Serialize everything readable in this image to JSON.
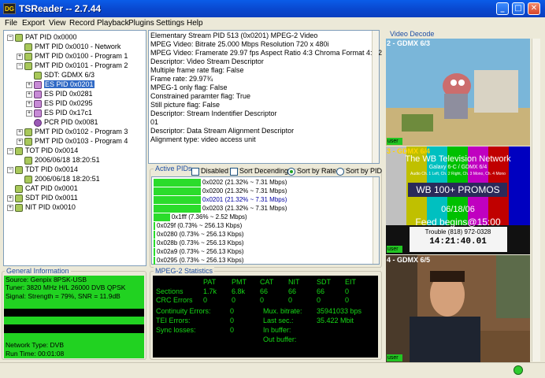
{
  "window": {
    "title": "TSReader -- 2.7.44",
    "app_icon_text": "DG"
  },
  "menu": [
    "File",
    "Export",
    "View",
    "Record",
    "Playback",
    "Plugins",
    "Settings",
    "Help"
  ],
  "tree": [
    {
      "label": "PAT PID 0x0000",
      "indent": 0,
      "exp": "−",
      "icon": "pid"
    },
    {
      "label": "PMT PID 0x0010 - Network",
      "indent": 1,
      "exp": "",
      "icon": "pid"
    },
    {
      "label": "PMT PID 0x0100 - Program 1",
      "indent": 1,
      "exp": "+",
      "icon": "pid"
    },
    {
      "label": "PMT PID 0x0101 - Program 2",
      "indent": 1,
      "exp": "−",
      "icon": "pid"
    },
    {
      "label": "SDT: GDMX 6/3",
      "indent": 2,
      "exp": "",
      "icon": "pid"
    },
    {
      "label": "ES PID 0x0201",
      "indent": 2,
      "exp": "+",
      "icon": "es",
      "selected": true
    },
    {
      "label": "ES PID 0x0281",
      "indent": 2,
      "exp": "+",
      "icon": "es"
    },
    {
      "label": "ES PID 0x0295",
      "indent": 2,
      "exp": "+",
      "icon": "es"
    },
    {
      "label": "ES PID 0x17c1",
      "indent": 2,
      "exp": "+",
      "icon": "es"
    },
    {
      "label": "PCR PID 0x0081",
      "indent": 2,
      "exp": "",
      "icon": "pcr"
    },
    {
      "label": "PMT PID 0x0102 - Program 3",
      "indent": 1,
      "exp": "+",
      "icon": "pid"
    },
    {
      "label": "PMT PID 0x0103 - Program 4",
      "indent": 1,
      "exp": "+",
      "icon": "pid"
    },
    {
      "label": "TOT PID 0x0014",
      "indent": 0,
      "exp": "−",
      "icon": "pid"
    },
    {
      "label": "2006/06/18 18:20:51",
      "indent": 1,
      "exp": "",
      "icon": "pid"
    },
    {
      "label": "TDT PID 0x0014",
      "indent": 0,
      "exp": "−",
      "icon": "pid"
    },
    {
      "label": "2006/06/18 18:20:51",
      "indent": 1,
      "exp": "",
      "icon": "pid"
    },
    {
      "label": "CAT PID 0x0001",
      "indent": 0,
      "exp": "",
      "icon": "pid"
    },
    {
      "label": "SDT PID 0x0011",
      "indent": 0,
      "exp": "+",
      "icon": "pid"
    },
    {
      "label": "NIT PID 0x0010",
      "indent": 0,
      "exp": "+",
      "icon": "pid"
    }
  ],
  "description": [
    "Elementary Stream PID 513 (0x0201) MPEG-2 Video",
    "MPEG Video: Bitrate 25.000 Mbps Resolution 720 x 480i",
    "MPEG Video: Framerate 29.97 fps Aspect Ratio 4:3 Chroma Format 4:2:2",
    "Descriptor: Video Stream Descriptor",
    " Multiple frame rate flag: False",
    " Frame rate: 29.97¾",
    " MPEG-1 only flag: False",
    " Constrained paramter flag: True",
    " Still picture flag: False",
    "Descriptor: Stream Indentifier Descriptor",
    " 01",
    "Descriptor: Data Stream Alignment Descriptor",
    " Alignment type: video access unit"
  ],
  "active_pids": {
    "label": "Active PIDs",
    "options": {
      "disabled": "Disabled",
      "sort_desc": "Sort Decending",
      "sort_rate": "Sort by Rate",
      "sort_pid": "Sort by PID"
    },
    "rows": [
      {
        "text": "0x0202 (21.32% ~ 7.31 Mbps)",
        "pct": 21.32
      },
      {
        "text": "0x0200 (21.32% ~ 7.31 Mbps)",
        "pct": 21.32
      },
      {
        "text": "0x0201 (21.32% ~ 7.31 Mbps)",
        "pct": 21.32,
        "selected": true
      },
      {
        "text": "0x0203 (21.32% ~ 7.31 Mbps)",
        "pct": 21.32
      },
      {
        "text": "0x1fff (7.36% ~ 2.52 Mbps)",
        "pct": 7.36
      },
      {
        "text": "0x029f (0.73% ~ 256.13 Kbps)",
        "pct": 0.73
      },
      {
        "text": "0x0280 (0.73% ~ 256.13 Kbps)",
        "pct": 0.73
      },
      {
        "text": "0x028b (0.73% ~ 256.13 Kbps)",
        "pct": 0.73
      },
      {
        "text": "0x02a9 (0.73% ~ 256.13 Kbps)",
        "pct": 0.73
      },
      {
        "text": "0x0295 (0.73% ~ 256.13 Kbps)",
        "pct": 0.73
      }
    ]
  },
  "general_info": {
    "label": "General Information",
    "lines": [
      {
        "text": "Source: Genpix 8PSK-USB",
        "color": "#21d221"
      },
      {
        "text": "Tuner: 3820 MHz H/L 26000 DVB QPSK",
        "color": "#21d221"
      },
      {
        "text": "Signal: Strength = 79%, SNR = 11.9dB",
        "color": "#21d221"
      },
      {
        "text": "",
        "color": "#21d221"
      },
      {
        "text": "",
        "color": "#000000"
      },
      {
        "text": "",
        "color": "#21d221"
      },
      {
        "text": "",
        "color": "#000000"
      },
      {
        "text": "",
        "color": "#21d221"
      },
      {
        "text": "Network Type: DVB",
        "color": "#21d221"
      },
      {
        "text": "Run Time: 00:01:08",
        "color": "#21d221"
      }
    ]
  },
  "mpeg_stats": {
    "label": "MPEG-2 Statistics",
    "headers": [
      "PAT",
      "PMT",
      "CAT",
      "NIT",
      "SDT",
      "EIT"
    ],
    "sections_label": "Sections",
    "sections": [
      "1.7k",
      "6.8k",
      "66",
      "66",
      "66",
      "0"
    ],
    "crc_label": "CRC Errors",
    "crc": [
      "0",
      "0",
      "0",
      "0",
      "0",
      "0"
    ],
    "continuity_label": "Continuity Errors:",
    "continuity": "0",
    "tei_label": "TEI Errors:",
    "tei": "0",
    "sync_label": "Sync losses:",
    "sync": "0",
    "mux_label": "Mux. bitrate:",
    "mux": "35941033 bps",
    "lastsec_label": "Last sec.:",
    "lastsec": "35.422 Mbit",
    "inbuf_label": "In buffer:",
    "outbuf_label": "Out buffer:"
  },
  "video": {
    "label": "Video Decode",
    "panels": [
      {
        "title": "2 - GDMX 6/3",
        "user": "user"
      },
      {
        "title": "3 - GDMX 6/4",
        "user": "user",
        "overlay": [
          "The WB Television Network",
          "Galaxy 6-C / GDMX 6/4",
          "Audio Ch. 1 Left, Ch. 2 Right, Ch. 3 Mono, Ch. 4 Mono",
          "WB 100+ PROMOS",
          "06/18/06",
          "Feed begins@15:00",
          "Trouble (818) 972-0328",
          "14:21:40.01"
        ]
      },
      {
        "title": "4 - GDMX 6/5",
        "user": "user"
      }
    ]
  }
}
